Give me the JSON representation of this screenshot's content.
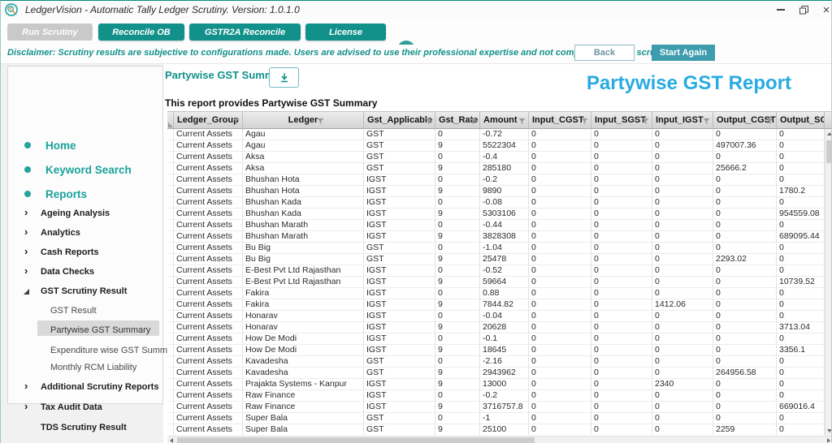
{
  "window": {
    "title": "LedgerVision - Automatic Tally Ledger Scrutiny.  Version: 1.0.1.0"
  },
  "toolbar": {
    "run_scrutiny": "Run Scrutiny",
    "reconcile_ob": "Reconcile OB",
    "gstr2a": "GSTR2A Reconcile",
    "license": "License"
  },
  "actionbar": {
    "disclaimer": "Disclaimer: Scrutiny results are subjective to configurations made. Users are advised to use their professional expertise and not completely rely on scrutiny results.",
    "back": "Back",
    "start_again": "Start Again"
  },
  "sidebar": {
    "primary": [
      {
        "label": "Home"
      },
      {
        "label": "Keyword Search"
      },
      {
        "label": "Reports"
      }
    ],
    "tree": [
      {
        "label": "Ageing Analysis"
      },
      {
        "label": "Analytics"
      },
      {
        "label": "Cash Reports"
      },
      {
        "label": "Data Checks"
      },
      {
        "label": "GST Scrutiny Result"
      }
    ],
    "gst_children": [
      {
        "label": "GST Result"
      },
      {
        "label": "Partywise GST Summary",
        "selected": true
      },
      {
        "label": "Expenditure wise GST Summary"
      },
      {
        "label": "Monthly RCM Liability"
      }
    ],
    "bottom": [
      {
        "label": "Additional Scrutiny Reports"
      },
      {
        "label": "Tax Audit Data"
      },
      {
        "label": "TDS Scrutiny Result"
      }
    ]
  },
  "content": {
    "section_title": "Partywise GST Summary",
    "report_title": "Partywise GST Report",
    "description": "This report provides Partywise GST Summary"
  },
  "table": {
    "columns": [
      "Ledger_Group",
      "Ledger",
      "Gst_Applicable",
      "Gst_Rate",
      "Amount",
      "Input_CGST",
      "Input_SGST",
      "Input_IGST",
      "Output_CGST",
      "Output_SGST"
    ],
    "rows": [
      [
        "Current Assets",
        "Agau",
        "GST",
        "0",
        "-0.72",
        "0",
        "0",
        "0",
        "0",
        "0"
      ],
      [
        "Current Assets",
        "Agau",
        "GST",
        "9",
        "5522304",
        "0",
        "0",
        "0",
        "497007.36",
        "0"
      ],
      [
        "Current Assets",
        "Aksa",
        "GST",
        "0",
        "-0.4",
        "0",
        "0",
        "0",
        "0",
        "0"
      ],
      [
        "Current Assets",
        "Aksa",
        "GST",
        "9",
        "285180",
        "0",
        "0",
        "0",
        "25666.2",
        "0"
      ],
      [
        "Current Assets",
        "Bhushan Hota",
        "IGST",
        "0",
        "-0.2",
        "0",
        "0",
        "0",
        "0",
        "0"
      ],
      [
        "Current Assets",
        "Bhushan Hota",
        "IGST",
        "9",
        "9890",
        "0",
        "0",
        "0",
        "0",
        "1780.2"
      ],
      [
        "Current Assets",
        "Bhushan Kada",
        "IGST",
        "0",
        "-0.08",
        "0",
        "0",
        "0",
        "0",
        "0"
      ],
      [
        "Current Assets",
        "Bhushan Kada",
        "IGST",
        "9",
        "5303106",
        "0",
        "0",
        "0",
        "0",
        "954559.08"
      ],
      [
        "Current Assets",
        "Bhushan Marath",
        "IGST",
        "0",
        "-0.44",
        "0",
        "0",
        "0",
        "0",
        "0"
      ],
      [
        "Current Assets",
        "Bhushan Marath",
        "IGST",
        "9",
        "3828308",
        "0",
        "0",
        "0",
        "0",
        "689095.44"
      ],
      [
        "Current Assets",
        "Bu Big",
        "GST",
        "0",
        "-1.04",
        "0",
        "0",
        "0",
        "0",
        "0"
      ],
      [
        "Current Assets",
        "Bu Big",
        "GST",
        "9",
        "25478",
        "0",
        "0",
        "0",
        "2293.02",
        "0"
      ],
      [
        "Current Assets",
        "E-Best Pvt Ltd Rajasthan",
        "IGST",
        "0",
        "-0.52",
        "0",
        "0",
        "0",
        "0",
        "0"
      ],
      [
        "Current Assets",
        "E-Best Pvt Ltd Rajasthan",
        "IGST",
        "9",
        "59664",
        "0",
        "0",
        "0",
        "0",
        "10739.52"
      ],
      [
        "Current Assets",
        "Fakira",
        "IGST",
        "0",
        "0.88",
        "0",
        "0",
        "0",
        "0",
        "0"
      ],
      [
        "Current Assets",
        "Fakira",
        "IGST",
        "9",
        "7844.82",
        "0",
        "0",
        "1412.06",
        "0",
        "0"
      ],
      [
        "Current Assets",
        "Honarav",
        "IGST",
        "0",
        "-0.04",
        "0",
        "0",
        "0",
        "0",
        "0"
      ],
      [
        "Current Assets",
        "Honarav",
        "IGST",
        "9",
        "20628",
        "0",
        "0",
        "0",
        "0",
        "3713.04"
      ],
      [
        "Current Assets",
        "How De Modi",
        "IGST",
        "0",
        "-0.1",
        "0",
        "0",
        "0",
        "0",
        "0"
      ],
      [
        "Current Assets",
        "How De Modi",
        "IGST",
        "9",
        "18645",
        "0",
        "0",
        "0",
        "0",
        "3356.1"
      ],
      [
        "Current Assets",
        "Kavadesha",
        "GST",
        "0",
        "-2.16",
        "0",
        "0",
        "0",
        "0",
        "0"
      ],
      [
        "Current Assets",
        "Kavadesha",
        "GST",
        "9",
        "2943962",
        "0",
        "0",
        "0",
        "264956.58",
        "0"
      ],
      [
        "Current Assets",
        "Prajakta Systems - Kanpur",
        "IGST",
        "9",
        "13000",
        "0",
        "0",
        "2340",
        "0",
        "0"
      ],
      [
        "Current Assets",
        "Raw Finance",
        "IGST",
        "0",
        "-0.2",
        "0",
        "0",
        "0",
        "0",
        "0"
      ],
      [
        "Current Assets",
        "Raw Finance",
        "IGST",
        "9",
        "3716757.8",
        "0",
        "0",
        "0",
        "0",
        "669016.4"
      ],
      [
        "Current Assets",
        "Super Bala",
        "GST",
        "0",
        "-1",
        "0",
        "0",
        "0",
        "0",
        "0"
      ],
      [
        "Current Assets",
        "Super Bala",
        "GST",
        "9",
        "25100",
        "0",
        "0",
        "0",
        "2259",
        "0"
      ]
    ]
  },
  "colors": {
    "teal": "#12918B",
    "report_title_blue": "#29ABE2",
    "start_again": "#3D9CAD",
    "disabled_button": "#C9C9C9"
  }
}
